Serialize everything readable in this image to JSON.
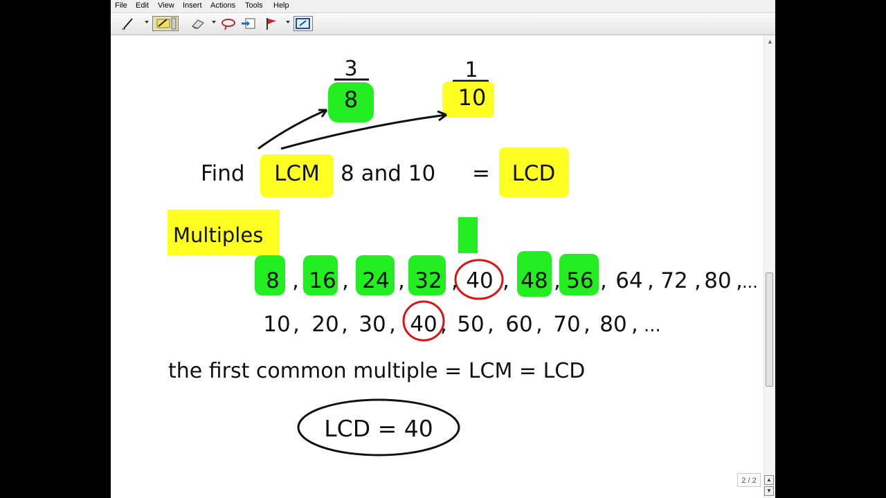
{
  "menu": [
    "File",
    "Edit",
    "View",
    "Insert",
    "Actions",
    "Tools",
    "Help"
  ],
  "toolbar": {
    "tools": [
      "pen-icon",
      "highlighter-icon",
      "eraser-icon",
      "lasso-icon",
      "insert-space-icon",
      "flag-icon",
      "screenshot-icon"
    ]
  },
  "lesson": {
    "fraction_a": {
      "numerator": "3",
      "denominator": "8"
    },
    "fraction_b": {
      "numerator": "1",
      "denominator": "10"
    },
    "find_line": {
      "find": "Find",
      "lcm": "LCM",
      "mid": "8 and 10",
      "eq": "=",
      "lcd": "LCD"
    },
    "multiples_label": "Multiples",
    "multiples_of_8": [
      "8",
      "16",
      "24",
      "32",
      "40",
      "48",
      "56",
      "64",
      "72",
      "80"
    ],
    "multiples_of_8_end": "...",
    "multiples_of_10": [
      "10",
      "20",
      "30",
      "40",
      "50",
      "60",
      "70",
      "80"
    ],
    "multiples_of_10_end": "...",
    "conclusion": "the first common multiple = LCM = LCD",
    "answer": "LCD = 40"
  },
  "colors": {
    "green": "#22ee22",
    "yellow": "#ffff22",
    "red": "#dd1111",
    "ink": "#111111"
  },
  "page_indicator": "2 / 2"
}
